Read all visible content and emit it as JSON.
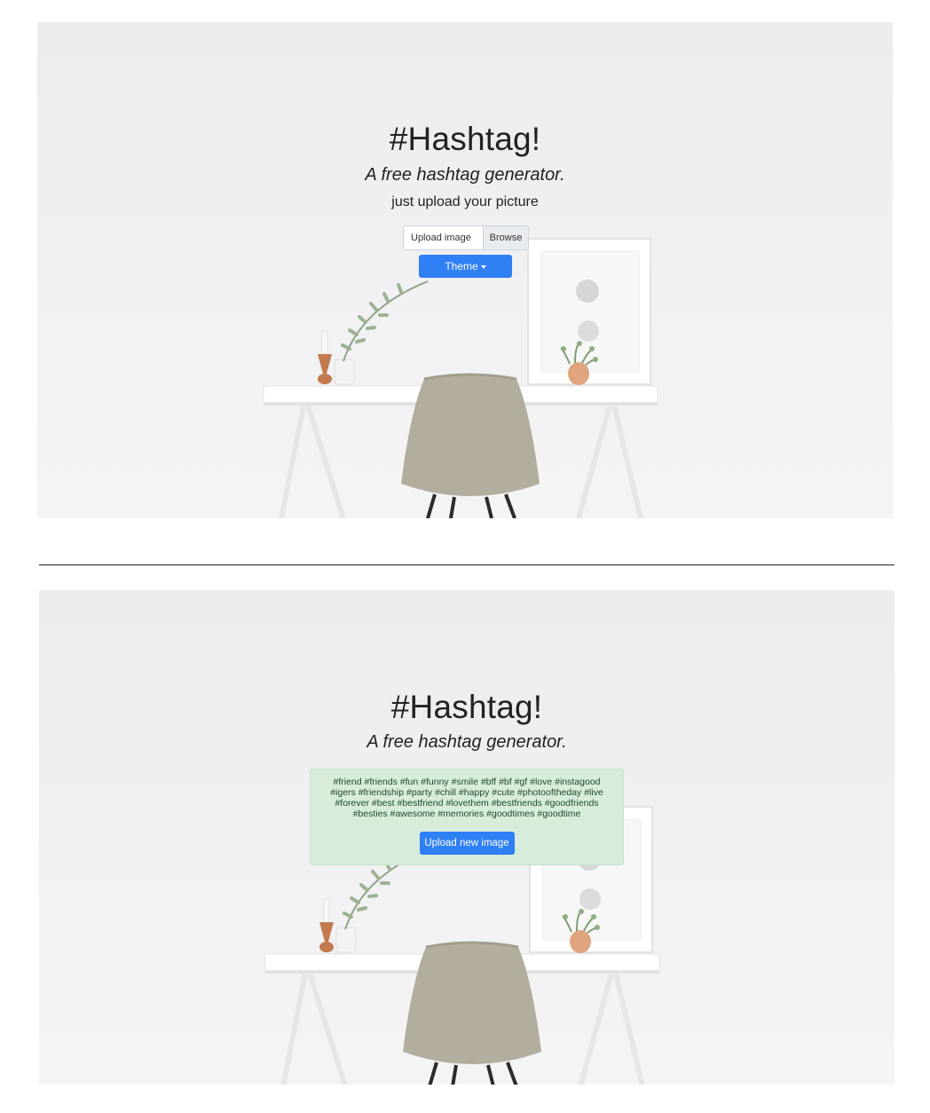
{
  "upload_screen": {
    "title": "#Hashtag!",
    "subtitle": "A free hashtag generator.",
    "lead": "just upload your picture",
    "upload_label": "Upload image",
    "browse_label": "Browse",
    "theme_label": "Theme"
  },
  "result_screen": {
    "title": "#Hashtag!",
    "subtitle": "A free hashtag generator.",
    "hashtags": "#friend #friends #fun #funny #smile #bff #bf #gf #love #instagood #igers #friendship #party #chill #happy #cute #photooftheday #live #forever #best #bestfriend #lovethem #bestfriends #goodfriends #besties #awesome #memories #goodtimes #goodtime",
    "upload_new_label": "Upload new image"
  },
  "colors": {
    "primary_button": "#2f7ff5",
    "result_background": "#d8ecdb",
    "hashtag_text": "#1c4a28"
  },
  "icons": {
    "theme_dropdown": "caret-down-icon"
  }
}
